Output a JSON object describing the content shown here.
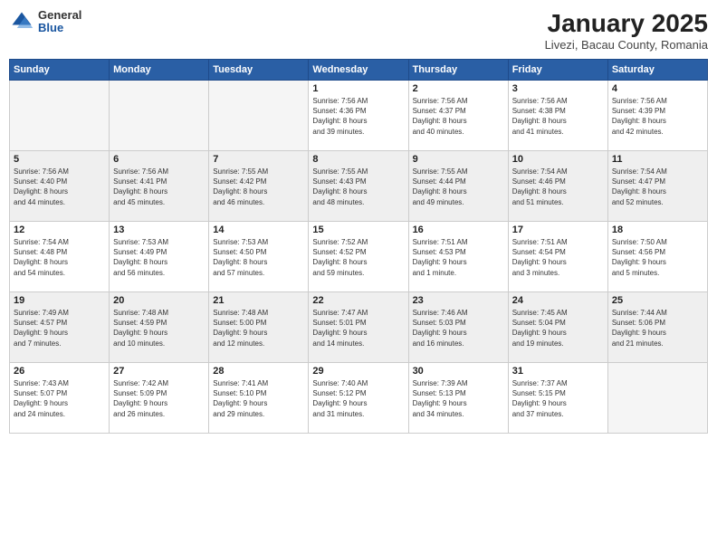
{
  "logo": {
    "general": "General",
    "blue": "Blue"
  },
  "header": {
    "title": "January 2025",
    "subtitle": "Livezi, Bacau County, Romania"
  },
  "weekdays": [
    "Sunday",
    "Monday",
    "Tuesday",
    "Wednesday",
    "Thursday",
    "Friday",
    "Saturday"
  ],
  "weeks": [
    [
      {
        "day": "",
        "info": ""
      },
      {
        "day": "",
        "info": ""
      },
      {
        "day": "",
        "info": ""
      },
      {
        "day": "1",
        "info": "Sunrise: 7:56 AM\nSunset: 4:36 PM\nDaylight: 8 hours\nand 39 minutes."
      },
      {
        "day": "2",
        "info": "Sunrise: 7:56 AM\nSunset: 4:37 PM\nDaylight: 8 hours\nand 40 minutes."
      },
      {
        "day": "3",
        "info": "Sunrise: 7:56 AM\nSunset: 4:38 PM\nDaylight: 8 hours\nand 41 minutes."
      },
      {
        "day": "4",
        "info": "Sunrise: 7:56 AM\nSunset: 4:39 PM\nDaylight: 8 hours\nand 42 minutes."
      }
    ],
    [
      {
        "day": "5",
        "info": "Sunrise: 7:56 AM\nSunset: 4:40 PM\nDaylight: 8 hours\nand 44 minutes."
      },
      {
        "day": "6",
        "info": "Sunrise: 7:56 AM\nSunset: 4:41 PM\nDaylight: 8 hours\nand 45 minutes."
      },
      {
        "day": "7",
        "info": "Sunrise: 7:55 AM\nSunset: 4:42 PM\nDaylight: 8 hours\nand 46 minutes."
      },
      {
        "day": "8",
        "info": "Sunrise: 7:55 AM\nSunset: 4:43 PM\nDaylight: 8 hours\nand 48 minutes."
      },
      {
        "day": "9",
        "info": "Sunrise: 7:55 AM\nSunset: 4:44 PM\nDaylight: 8 hours\nand 49 minutes."
      },
      {
        "day": "10",
        "info": "Sunrise: 7:54 AM\nSunset: 4:46 PM\nDaylight: 8 hours\nand 51 minutes."
      },
      {
        "day": "11",
        "info": "Sunrise: 7:54 AM\nSunset: 4:47 PM\nDaylight: 8 hours\nand 52 minutes."
      }
    ],
    [
      {
        "day": "12",
        "info": "Sunrise: 7:54 AM\nSunset: 4:48 PM\nDaylight: 8 hours\nand 54 minutes."
      },
      {
        "day": "13",
        "info": "Sunrise: 7:53 AM\nSunset: 4:49 PM\nDaylight: 8 hours\nand 56 minutes."
      },
      {
        "day": "14",
        "info": "Sunrise: 7:53 AM\nSunset: 4:50 PM\nDaylight: 8 hours\nand 57 minutes."
      },
      {
        "day": "15",
        "info": "Sunrise: 7:52 AM\nSunset: 4:52 PM\nDaylight: 8 hours\nand 59 minutes."
      },
      {
        "day": "16",
        "info": "Sunrise: 7:51 AM\nSunset: 4:53 PM\nDaylight: 9 hours\nand 1 minute."
      },
      {
        "day": "17",
        "info": "Sunrise: 7:51 AM\nSunset: 4:54 PM\nDaylight: 9 hours\nand 3 minutes."
      },
      {
        "day": "18",
        "info": "Sunrise: 7:50 AM\nSunset: 4:56 PM\nDaylight: 9 hours\nand 5 minutes."
      }
    ],
    [
      {
        "day": "19",
        "info": "Sunrise: 7:49 AM\nSunset: 4:57 PM\nDaylight: 9 hours\nand 7 minutes."
      },
      {
        "day": "20",
        "info": "Sunrise: 7:48 AM\nSunset: 4:59 PM\nDaylight: 9 hours\nand 10 minutes."
      },
      {
        "day": "21",
        "info": "Sunrise: 7:48 AM\nSunset: 5:00 PM\nDaylight: 9 hours\nand 12 minutes."
      },
      {
        "day": "22",
        "info": "Sunrise: 7:47 AM\nSunset: 5:01 PM\nDaylight: 9 hours\nand 14 minutes."
      },
      {
        "day": "23",
        "info": "Sunrise: 7:46 AM\nSunset: 5:03 PM\nDaylight: 9 hours\nand 16 minutes."
      },
      {
        "day": "24",
        "info": "Sunrise: 7:45 AM\nSunset: 5:04 PM\nDaylight: 9 hours\nand 19 minutes."
      },
      {
        "day": "25",
        "info": "Sunrise: 7:44 AM\nSunset: 5:06 PM\nDaylight: 9 hours\nand 21 minutes."
      }
    ],
    [
      {
        "day": "26",
        "info": "Sunrise: 7:43 AM\nSunset: 5:07 PM\nDaylight: 9 hours\nand 24 minutes."
      },
      {
        "day": "27",
        "info": "Sunrise: 7:42 AM\nSunset: 5:09 PM\nDaylight: 9 hours\nand 26 minutes."
      },
      {
        "day": "28",
        "info": "Sunrise: 7:41 AM\nSunset: 5:10 PM\nDaylight: 9 hours\nand 29 minutes."
      },
      {
        "day": "29",
        "info": "Sunrise: 7:40 AM\nSunset: 5:12 PM\nDaylight: 9 hours\nand 31 minutes."
      },
      {
        "day": "30",
        "info": "Sunrise: 7:39 AM\nSunset: 5:13 PM\nDaylight: 9 hours\nand 34 minutes."
      },
      {
        "day": "31",
        "info": "Sunrise: 7:37 AM\nSunset: 5:15 PM\nDaylight: 9 hours\nand 37 minutes."
      },
      {
        "day": "",
        "info": ""
      }
    ]
  ]
}
